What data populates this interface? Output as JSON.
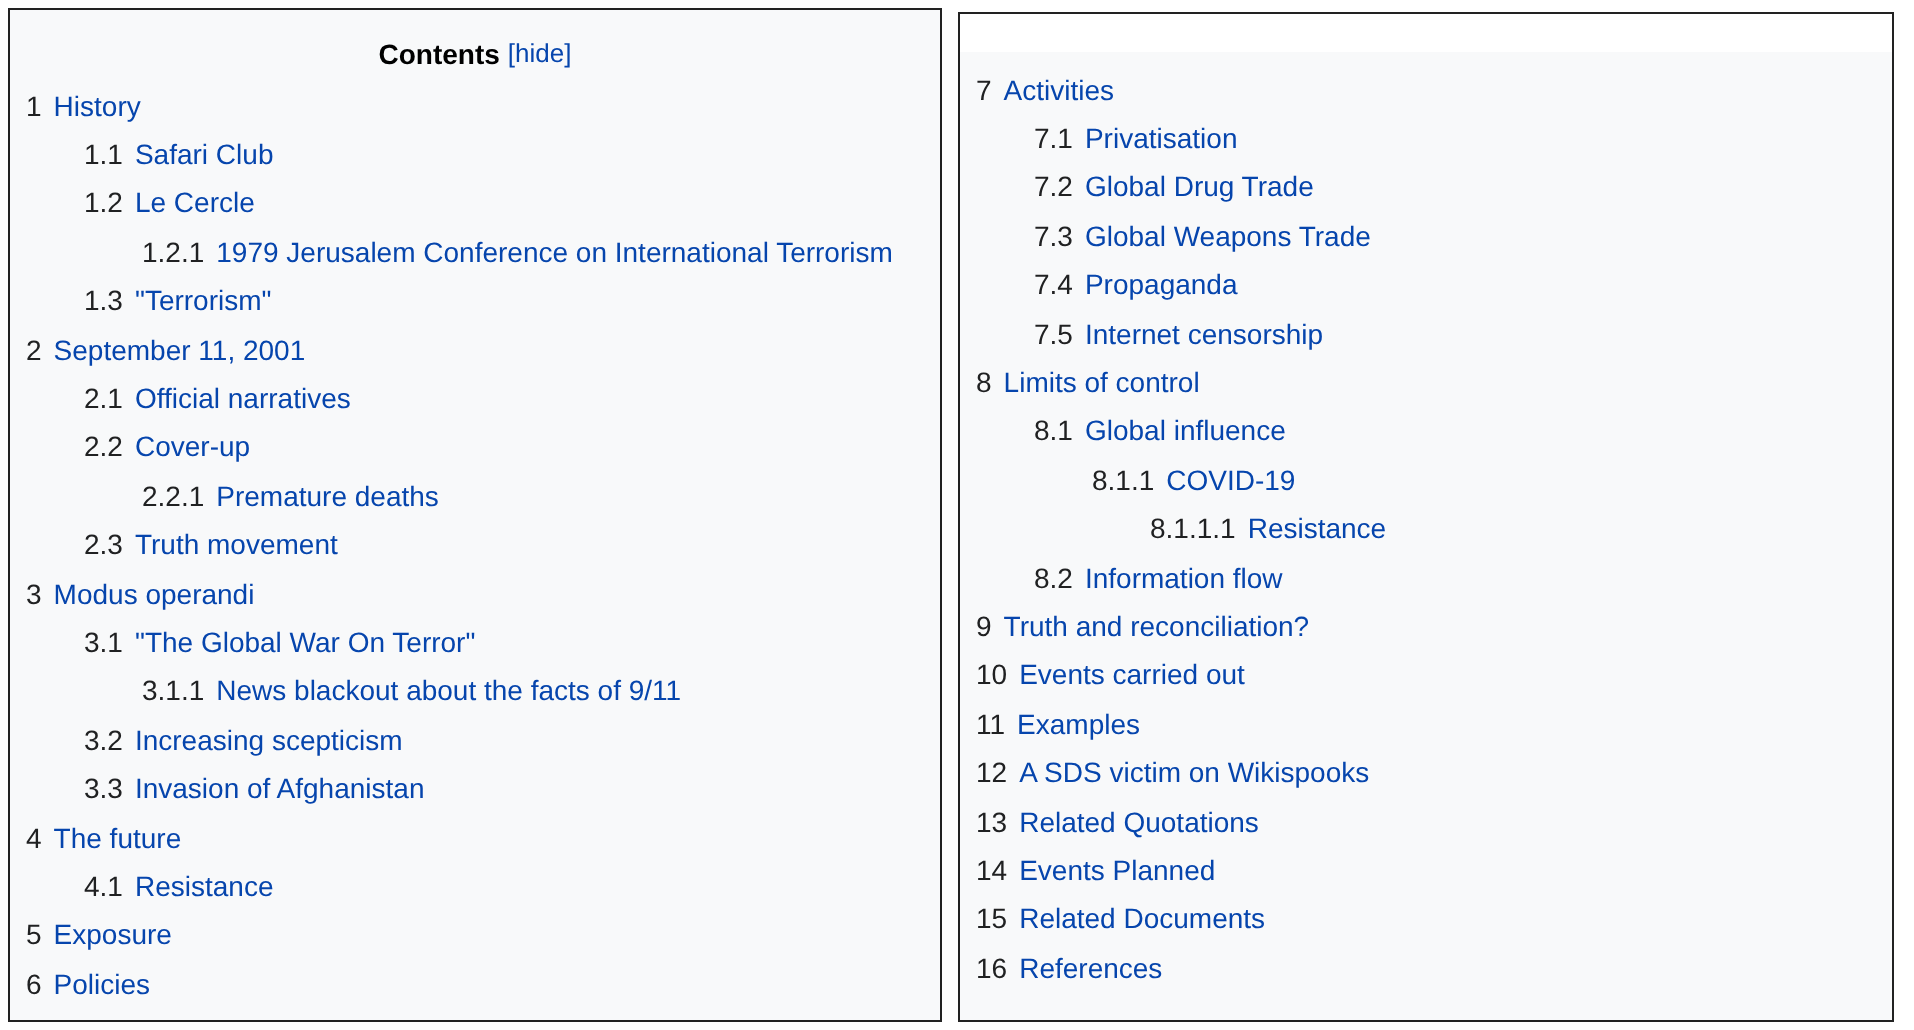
{
  "panels": [
    {
      "title": "Contents",
      "toggle": "[hide]",
      "items": [
        {
          "number": "1",
          "text": "History",
          "children": [
            {
              "number": "1.1",
              "text": "Safari Club"
            },
            {
              "number": "1.2",
              "text": "Le Cercle",
              "children": [
                {
                  "number": "1.2.1",
                  "text": "1979 Jerusalem Conference on International Terrorism"
                }
              ]
            },
            {
              "number": "1.3",
              "text": "\"Terrorism\""
            }
          ]
        },
        {
          "number": "2",
          "text": "September 11, 2001",
          "children": [
            {
              "number": "2.1",
              "text": "Official narratives"
            },
            {
              "number": "2.2",
              "text": "Cover-up",
              "children": [
                {
                  "number": "2.2.1",
                  "text": "Premature deaths"
                }
              ]
            },
            {
              "number": "2.3",
              "text": "Truth movement"
            }
          ]
        },
        {
          "number": "3",
          "text": "Modus operandi",
          "children": [
            {
              "number": "3.1",
              "text": "\"The Global War On Terror\"",
              "children": [
                {
                  "number": "3.1.1",
                  "text": "News blackout about the facts of 9/11"
                }
              ]
            },
            {
              "number": "3.2",
              "text": "Increasing scepticism"
            },
            {
              "number": "3.3",
              "text": "Invasion of Afghanistan"
            }
          ]
        },
        {
          "number": "4",
          "text": "The future",
          "children": [
            {
              "number": "4.1",
              "text": "Resistance"
            }
          ]
        },
        {
          "number": "5",
          "text": "Exposure"
        },
        {
          "number": "6",
          "text": "Policies"
        }
      ]
    },
    {
      "items": [
        {
          "number": "7",
          "text": "Activities",
          "children": [
            {
              "number": "7.1",
              "text": "Privatisation"
            },
            {
              "number": "7.2",
              "text": "Global Drug Trade"
            },
            {
              "number": "7.3",
              "text": "Global Weapons Trade"
            },
            {
              "number": "7.4",
              "text": "Propaganda"
            },
            {
              "number": "7.5",
              "text": "Internet censorship"
            }
          ]
        },
        {
          "number": "8",
          "text": "Limits of control",
          "children": [
            {
              "number": "8.1",
              "text": "Global influence",
              "children": [
                {
                  "number": "8.1.1",
                  "text": "COVID-19",
                  "children": [
                    {
                      "number": "8.1.1.1",
                      "text": "Resistance"
                    }
                  ]
                }
              ]
            },
            {
              "number": "8.2",
              "text": "Information flow"
            }
          ]
        },
        {
          "number": "9",
          "text": "Truth and reconciliation?"
        },
        {
          "number": "10",
          "text": "Events carried out"
        },
        {
          "number": "11",
          "text": "Examples"
        },
        {
          "number": "12",
          "text": "A SDS victim on Wikispooks"
        },
        {
          "number": "13",
          "text": "Related Quotations"
        },
        {
          "number": "14",
          "text": "Events Planned"
        },
        {
          "number": "15",
          "text": "Related Documents"
        },
        {
          "number": "16",
          "text": "References"
        }
      ]
    }
  ]
}
